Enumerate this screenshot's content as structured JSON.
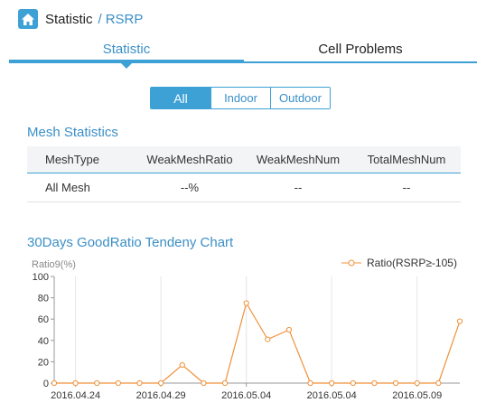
{
  "breadcrumb": {
    "title": "Statistic",
    "separator": "/",
    "current": "RSRP"
  },
  "tabs": [
    {
      "label": "Statistic",
      "active": true
    },
    {
      "label": "Cell Problems",
      "active": false
    }
  ],
  "filter": {
    "options": [
      "All",
      "Indoor",
      "Outdoor"
    ],
    "selected": "All"
  },
  "mesh": {
    "title": "Mesh Statistics",
    "columns": [
      "MeshType",
      "WeakMeshRatio",
      "WeakMeshNum",
      "TotalMeshNum"
    ],
    "rows": [
      [
        "All Mesh",
        "--%",
        "--",
        "--"
      ]
    ]
  },
  "chart_section_title": "30Days GoodRatio Tendeny Chart",
  "colors": {
    "accent": "#3da1d6",
    "series": "#f0913a"
  },
  "chart_data": {
    "type": "line",
    "ylabel": "Ratio9(%)",
    "ylim": [
      0,
      100
    ],
    "yticks": [
      0,
      20,
      40,
      60,
      80,
      100
    ],
    "x_tick_labels": [
      "2016.04.24",
      "2016.04.29",
      "2016.05.04",
      "2016.05.04",
      "2016.05.09"
    ],
    "x_tick_indices": [
      1,
      5,
      9,
      13,
      17
    ],
    "series": [
      {
        "name": "Ratio(RSRP≥-105)",
        "values": [
          0,
          0,
          0,
          0,
          0,
          0,
          17,
          0,
          0,
          75,
          41,
          50,
          0,
          0,
          0,
          0,
          0,
          0,
          0,
          58
        ]
      }
    ],
    "legend": "top-right",
    "grid": "vertical"
  }
}
